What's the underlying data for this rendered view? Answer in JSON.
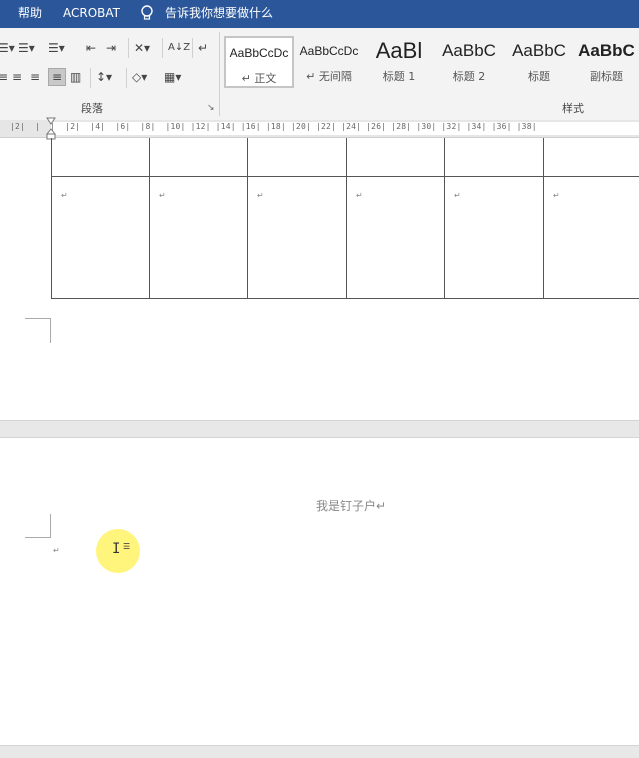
{
  "menubar": {
    "items": [
      "帮助",
      "ACROBAT"
    ],
    "tell_me": "告诉我你想要做什么"
  },
  "ribbon": {
    "paragraph_group": {
      "label": "段落",
      "row1": [
        "☰▾",
        "☰▾",
        "☰▾",
        "⇤",
        "⇥",
        "✕▾",
        "A↓Z",
        "↵"
      ],
      "row2": [
        "≡",
        "≡",
        "≡",
        "≡",
        "▥",
        "↕▾",
        "◇▾",
        "▦▾"
      ]
    },
    "styles_group": {
      "label": "样式",
      "tiles": [
        {
          "preview": "AaBbCcDc",
          "name": "↵ 正文",
          "size": "12px"
        },
        {
          "preview": "AaBbCcDc",
          "name": "↵ 无间隔",
          "size": "12px"
        },
        {
          "preview": "AaBl",
          "name": "标题 1",
          "size": "22px"
        },
        {
          "preview": "AaBbC",
          "name": "标题 2",
          "size": "17px"
        },
        {
          "preview": "AaBbC",
          "name": "标题",
          "size": "17px"
        },
        {
          "preview": "AaBbC",
          "name": "副标题",
          "size": "17px"
        }
      ]
    }
  },
  "ruler": {
    "numbers": "|2|  |  |  |2|  |4|  |6|  |8|  |10| |12| |14| |16| |18| |20| |22| |24| |26| |28| |30| |32| |34| |36| |38|"
  },
  "document": {
    "para_mark": "↵",
    "table_cells_row2": [
      "↵",
      "↵",
      "↵",
      "↵",
      "↵",
      "↵"
    ],
    "header_text": "我是钉子户↵",
    "body_para_mark": "↵"
  },
  "colors": {
    "title_bar": "#2b579a",
    "cursor_highlight": "#fff050"
  }
}
